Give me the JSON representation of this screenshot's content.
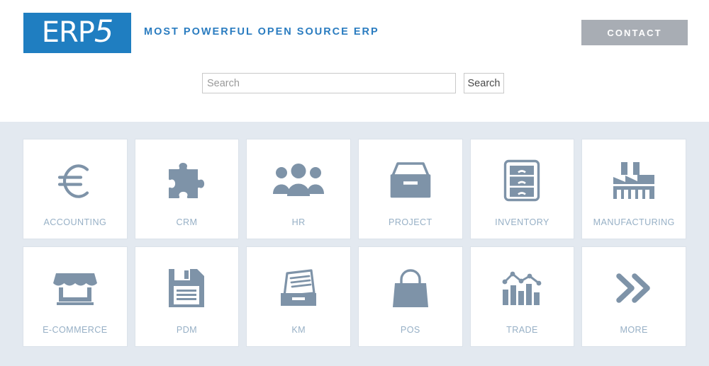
{
  "header": {
    "logo_text_main": "ERP",
    "logo_text_accent": "5",
    "tagline": "MOST POWERFUL OPEN SOURCE ERP",
    "contact_label": "CONTACT",
    "logo_bg_color": "#1f7ec1",
    "tagline_color": "#2a7cc0",
    "contact_bg_color": "#a8adb4"
  },
  "search": {
    "placeholder": "Search",
    "value": "",
    "button_label": "Search"
  },
  "panel": {
    "bg_color": "#e3e9f0",
    "tile_bg_color": "#ffffff",
    "tile_border_color": "#dbe2ea",
    "icon_color": "#7e93a8",
    "label_color": "#97b0c6"
  },
  "tiles": [
    {
      "label": "ACCOUNTING",
      "icon": "euro-icon"
    },
    {
      "label": "CRM",
      "icon": "puzzle-piece-icon"
    },
    {
      "label": "HR",
      "icon": "people-group-icon"
    },
    {
      "label": "PROJECT",
      "icon": "open-box-icon"
    },
    {
      "label": "INVENTORY",
      "icon": "filing-cabinet-icon"
    },
    {
      "label": "MANUFACTURING",
      "icon": "factory-icon"
    },
    {
      "label": "E-COMMERCE",
      "icon": "storefront-icon"
    },
    {
      "label": "PDM",
      "icon": "floppy-disk-icon"
    },
    {
      "label": "KM",
      "icon": "document-tray-icon"
    },
    {
      "label": "POS",
      "icon": "shopping-bag-icon"
    },
    {
      "label": "TRADE",
      "icon": "bar-chart-line-icon"
    },
    {
      "label": "MORE",
      "icon": "double-chevron-right-icon"
    }
  ]
}
